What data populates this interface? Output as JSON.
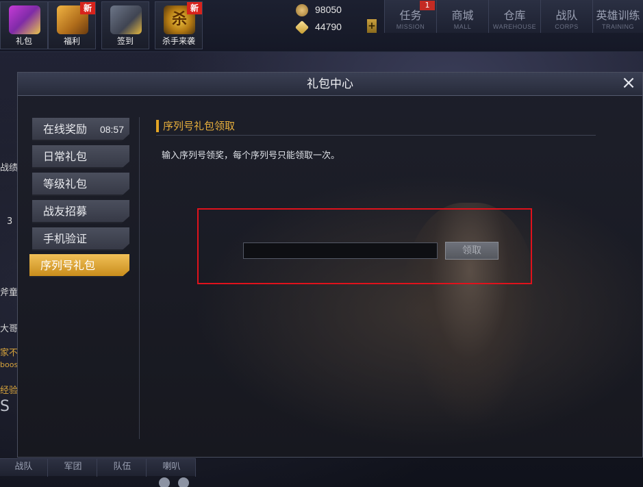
{
  "topbar": {
    "tiles": [
      {
        "label": "礼包",
        "new_badge": ""
      },
      {
        "label": "福利",
        "new_badge": "新"
      },
      {
        "label": "签到",
        "new_badge": ""
      },
      {
        "label": "杀手来袭",
        "new_badge": "新",
        "emblem": "杀"
      }
    ],
    "currency": {
      "gold": "98050",
      "diamond": "44790",
      "plus": "+"
    },
    "nav": [
      {
        "zh": "任务",
        "en": "MISSION",
        "badge": "1"
      },
      {
        "zh": "商城",
        "en": "MALL"
      },
      {
        "zh": "仓库",
        "en": "WAREHOUSE"
      },
      {
        "zh": "战队",
        "en": "CORPS"
      },
      {
        "zh": "英雄训练",
        "en": "TRAINING"
      }
    ]
  },
  "left_sliver": {
    "texts": [
      "战绩",
      "3",
      "斧童",
      "大哥",
      "家不",
      "boos",
      "经验",
      "S"
    ]
  },
  "bottom_tabs": [
    "战队",
    "军团",
    "队伍",
    "喇叭"
  ],
  "modal": {
    "title": "礼包中心",
    "close": "×",
    "menu": [
      {
        "label": "在线奖励",
        "time": "08:57"
      },
      {
        "label": "日常礼包"
      },
      {
        "label": "等级礼包"
      },
      {
        "label": "战友招募"
      },
      {
        "label": "手机验证"
      },
      {
        "label": "序列号礼包",
        "active": true
      }
    ],
    "section_title": "序列号礼包领取",
    "instruction": "输入序列号领奖，每个序列号只能领取一次。",
    "input_value": "",
    "input_placeholder": "",
    "claim_button": "领取"
  },
  "colors": {
    "accent_gold": "#e9b03c",
    "active_tab": "#d99a25",
    "highlight_red": "#e0121c",
    "badge_red": "#d8231c"
  }
}
